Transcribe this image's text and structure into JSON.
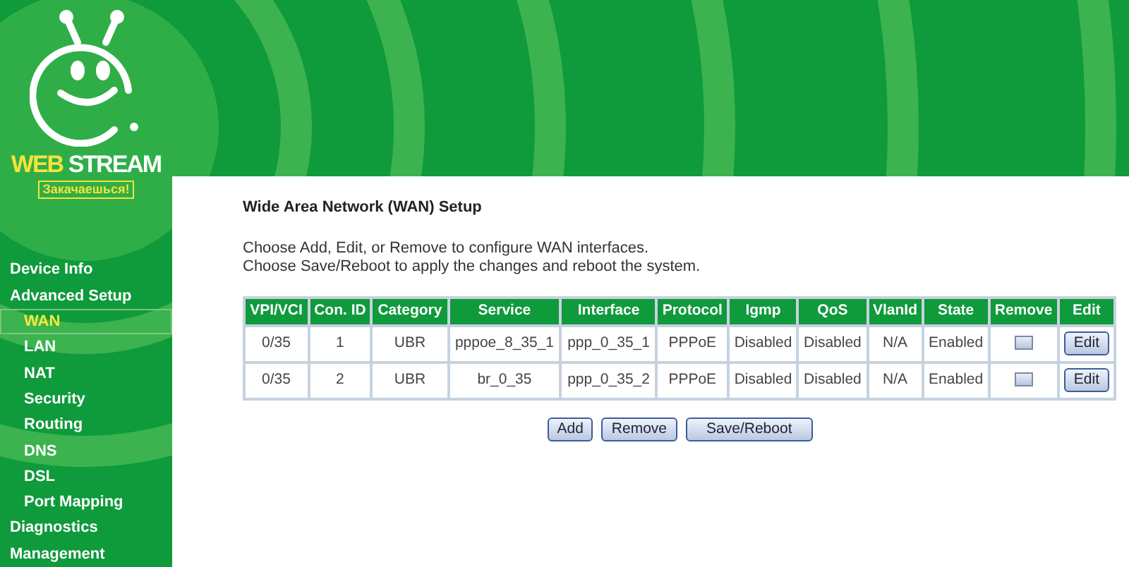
{
  "logo": {
    "brand_first": "WEB",
    "brand_second": "STREAM",
    "slogan": "Закачаешься!"
  },
  "sidebar": {
    "items": [
      {
        "label": "Device Info",
        "selected": false
      },
      {
        "label": "Advanced Setup",
        "selected": false,
        "children": [
          {
            "label": "WAN",
            "selected": true
          },
          {
            "label": "LAN",
            "selected": false
          },
          {
            "label": "NAT",
            "selected": false
          },
          {
            "label": "Security",
            "selected": false
          },
          {
            "label": "Routing",
            "selected": false
          },
          {
            "label": "DNS",
            "selected": false
          },
          {
            "label": "DSL",
            "selected": false
          },
          {
            "label": "Port Mapping",
            "selected": false
          }
        ]
      },
      {
        "label": "Diagnostics",
        "selected": false
      },
      {
        "label": "Management",
        "selected": false
      }
    ]
  },
  "title": "Wide Area Network (WAN) Setup",
  "description": [
    "Choose Add, Edit, or Remove to configure WAN interfaces.",
    "Choose Save/Reboot to apply the changes and reboot the system."
  ],
  "table": {
    "columns": [
      "VPI/VCI",
      "Con. ID",
      "Category",
      "Service",
      "Interface",
      "Protocol",
      "Igmp",
      "QoS",
      "VlanId",
      "State",
      "Remove",
      "Edit"
    ],
    "rows": [
      {
        "cells": [
          "0/35",
          "1",
          "UBR",
          "pppoe_8_35_1",
          "ppp_0_35_1",
          "PPPoE",
          "Disabled",
          "Disabled",
          "N/A",
          "Enabled"
        ],
        "remove_checked": false,
        "edit_label": "Edit"
      },
      {
        "cells": [
          "0/35",
          "2",
          "UBR",
          "br_0_35",
          "ppp_0_35_2",
          "PPPoE",
          "Disabled",
          "Disabled",
          "N/A",
          "Enabled"
        ],
        "remove_checked": false,
        "edit_label": "Edit"
      }
    ]
  },
  "buttons": [
    "Add",
    "Remove",
    "Save/Reboot"
  ]
}
